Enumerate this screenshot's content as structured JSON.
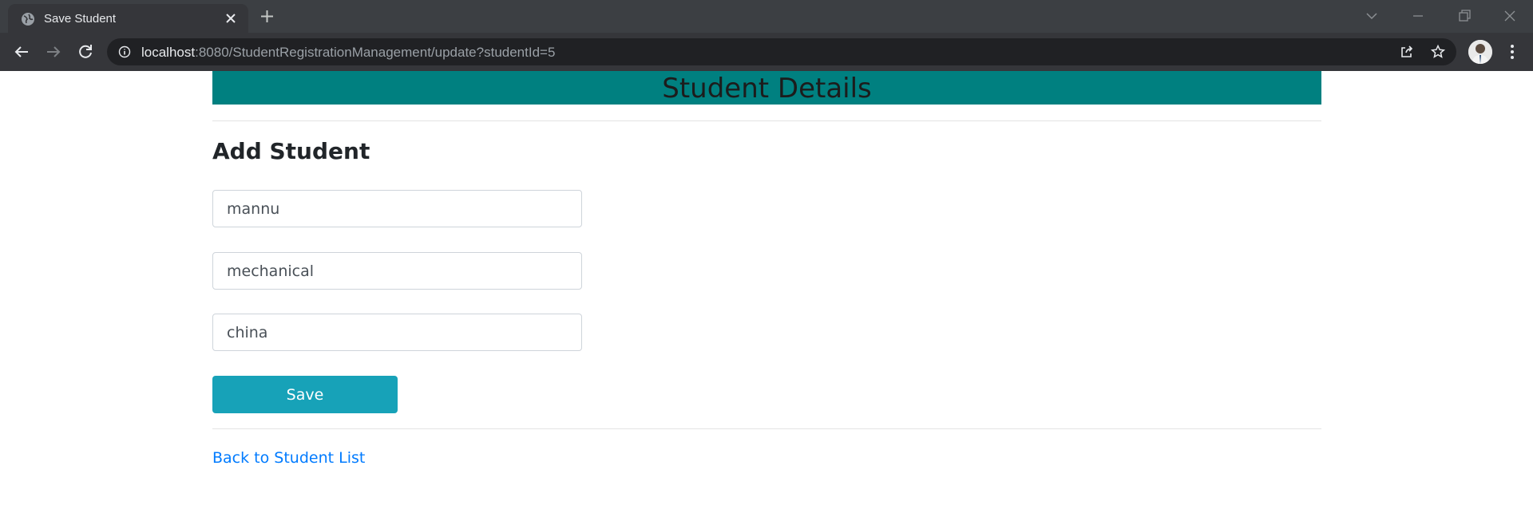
{
  "browser": {
    "tab_title": "Save Student",
    "url_host": "localhost",
    "url_rest": ":8080/StudentRegistrationManagement/update?studentId=5"
  },
  "page": {
    "header_title": "Student Details",
    "form_heading": "Add Student",
    "fields": [
      {
        "value": "mannu"
      },
      {
        "value": "mechanical"
      },
      {
        "value": "china"
      }
    ],
    "save_label": "Save",
    "back_link": "Back to Student List"
  },
  "colors": {
    "header_bg": "#008080",
    "button_bg": "#17a2b8",
    "link": "#007bff"
  },
  "icons": [
    "globe-icon",
    "close-icon",
    "plus-icon",
    "back-arrow-icon",
    "forward-arrow-icon",
    "reload-icon",
    "info-icon",
    "share-icon",
    "star-icon",
    "kebab-menu-icon"
  ]
}
